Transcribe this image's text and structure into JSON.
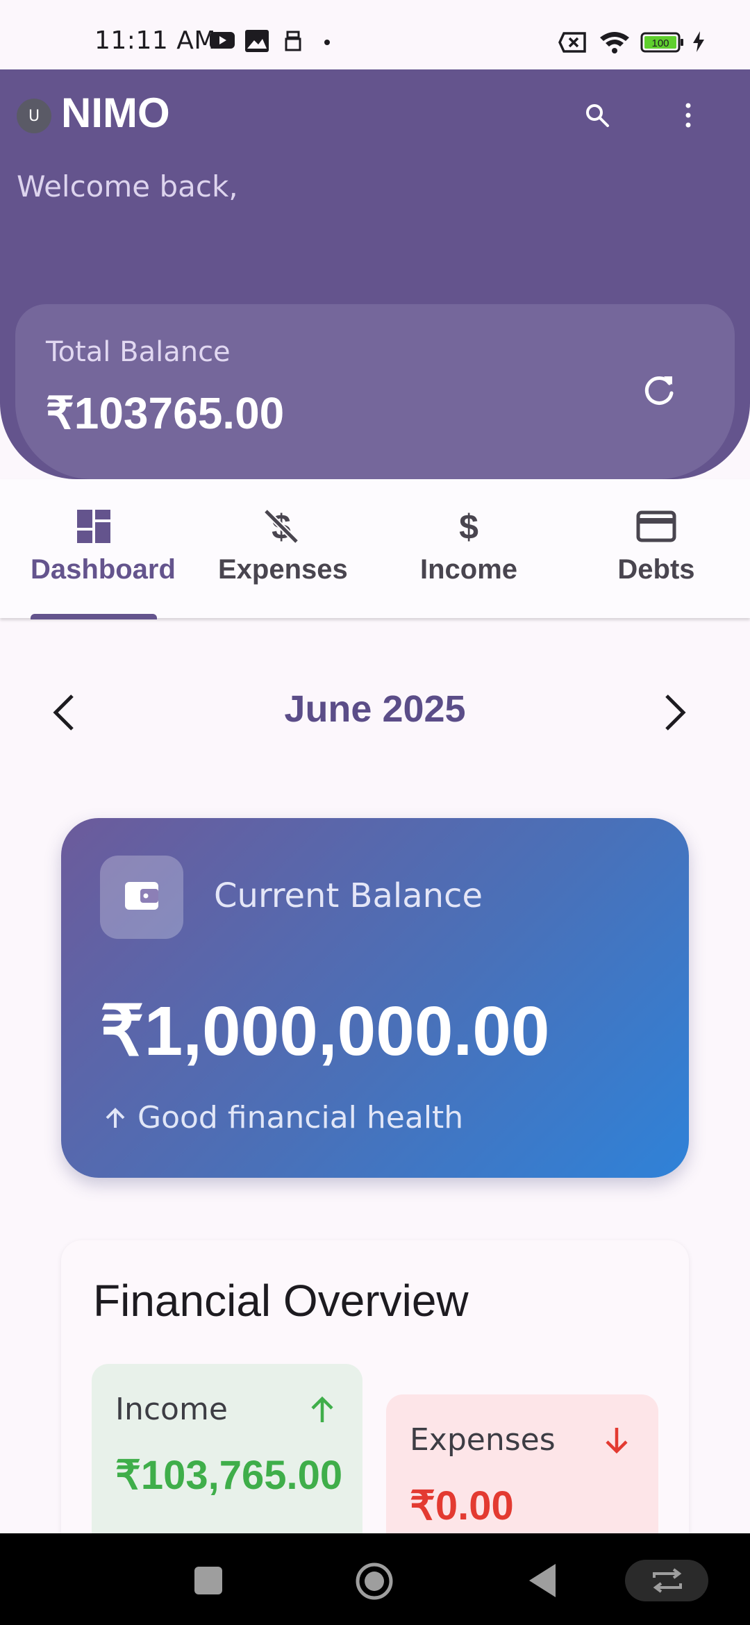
{
  "status_bar": {
    "time": "11:11 AM",
    "battery": "100"
  },
  "header": {
    "avatar_initial": "U",
    "app_title": "NIMO",
    "welcome": "Welcome back,",
    "total_balance_label": "Total Balance",
    "total_balance_value": "₹103765.00"
  },
  "tabs": [
    {
      "label": "Dashboard",
      "icon": "dashboard-icon",
      "active": true
    },
    {
      "label": "Expenses",
      "icon": "money-off-icon",
      "active": false
    },
    {
      "label": "Income",
      "icon": "dollar-icon",
      "active": false
    },
    {
      "label": "Debts",
      "icon": "credit-card-icon",
      "active": false
    }
  ],
  "month_nav": {
    "label": "June 2025"
  },
  "current_balance": {
    "label": "Current Balance",
    "value": "₹1,000,000.00",
    "health": "Good financial health"
  },
  "overview": {
    "title": "Financial Overview",
    "income_label": "Income",
    "income_value": "₹103,765.00",
    "expenses_label": "Expenses",
    "expenses_value": "₹0.00"
  },
  "colors": {
    "primary": "#64548d",
    "income": "#3fae4a",
    "expense": "#e33a31",
    "gradient_start": "#6c5b9b",
    "gradient_end": "#2f82d8"
  }
}
